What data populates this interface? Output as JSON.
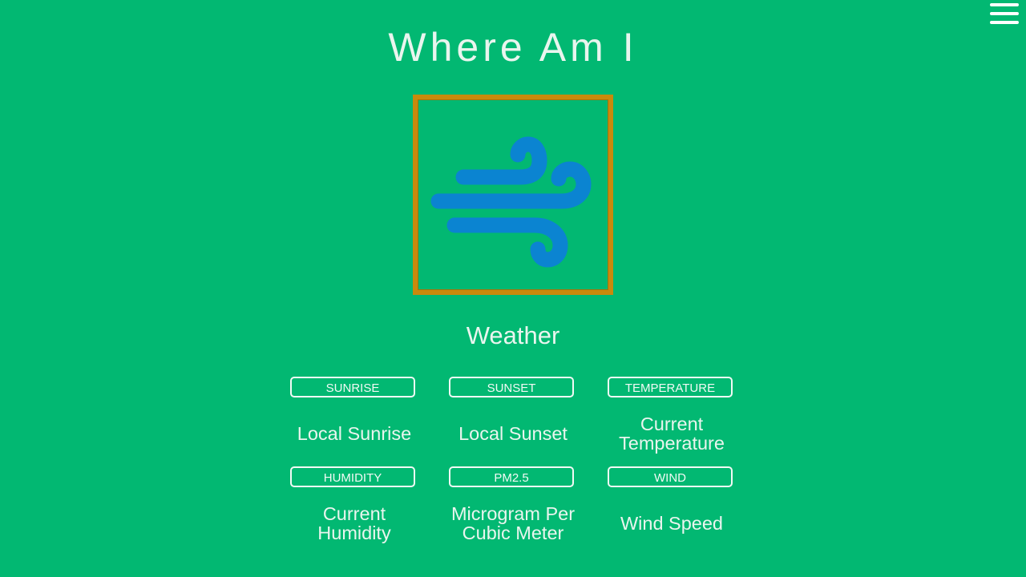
{
  "header": {
    "title": "Where Am I"
  },
  "weather_icon": {
    "icon": "wind-icon",
    "frame_color": "#c98a0c",
    "icon_color": "#0b84d1"
  },
  "section": {
    "title": "Weather"
  },
  "tiles": [
    {
      "button": "SUNRISE",
      "value": "Local Sunrise"
    },
    {
      "button": "SUNSET",
      "value": "Local Sunset"
    },
    {
      "button": "TEMPERATURE",
      "value": "Current Temperature"
    },
    {
      "button": "HUMIDITY",
      "value": "Current Humidity"
    },
    {
      "button": "PM2.5",
      "value": "Microgram Per Cubic Meter"
    },
    {
      "button": "WIND",
      "value": "Wind Speed"
    }
  ],
  "colors": {
    "background": "#02b872",
    "text": "#e9f5ee",
    "button_border": "#f2faf5"
  }
}
